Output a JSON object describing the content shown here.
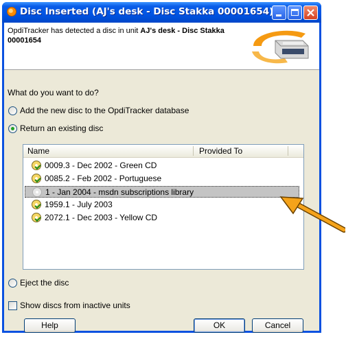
{
  "window": {
    "title": "Disc Inserted (AJ's desk - Disc Stakka 00001654)"
  },
  "header": {
    "message_prefix": "OpdiTracker has detected a disc in unit ",
    "unit_name": "AJ's desk - Disc Stakka 00001654"
  },
  "prompt": "What do you want to do?",
  "options": {
    "add_new": {
      "label": "Add the new disc to the OpdiTracker database",
      "checked": false
    },
    "return_existing": {
      "label": "Return an existing disc",
      "checked": true
    },
    "eject": {
      "label": "Eject the disc",
      "checked": false
    }
  },
  "discs_list": {
    "columns": [
      "Name",
      "Provided To"
    ],
    "rows": [
      {
        "name": "0009.3 - Dec 2002 - Green CD",
        "provided_to": "",
        "icon": "disc-returned-icon",
        "selected": false
      },
      {
        "name": "0085.2 - Feb 2002 - Portuguese",
        "provided_to": "",
        "icon": "disc-returned-icon",
        "selected": false
      },
      {
        "name": "1 - Jan 2004 - msdn subscriptions library",
        "provided_to": "",
        "icon": "disc-gray-icon",
        "selected": true
      },
      {
        "name": "1959.1 - July 2003",
        "provided_to": "",
        "icon": "disc-returned-icon",
        "selected": false
      },
      {
        "name": "2072.1 - Dec 2003 - Yellow CD",
        "provided_to": "",
        "icon": "disc-returned-icon",
        "selected": false
      }
    ]
  },
  "show_inactive": {
    "label": "Show discs from inactive units",
    "checked": false
  },
  "buttons": {
    "help": "Help",
    "ok": "OK",
    "cancel": "Cancel"
  },
  "colors": {
    "titlebar": "#0054e3",
    "dialog_bg": "#ece9d8",
    "arrow": "#f5a31a"
  }
}
